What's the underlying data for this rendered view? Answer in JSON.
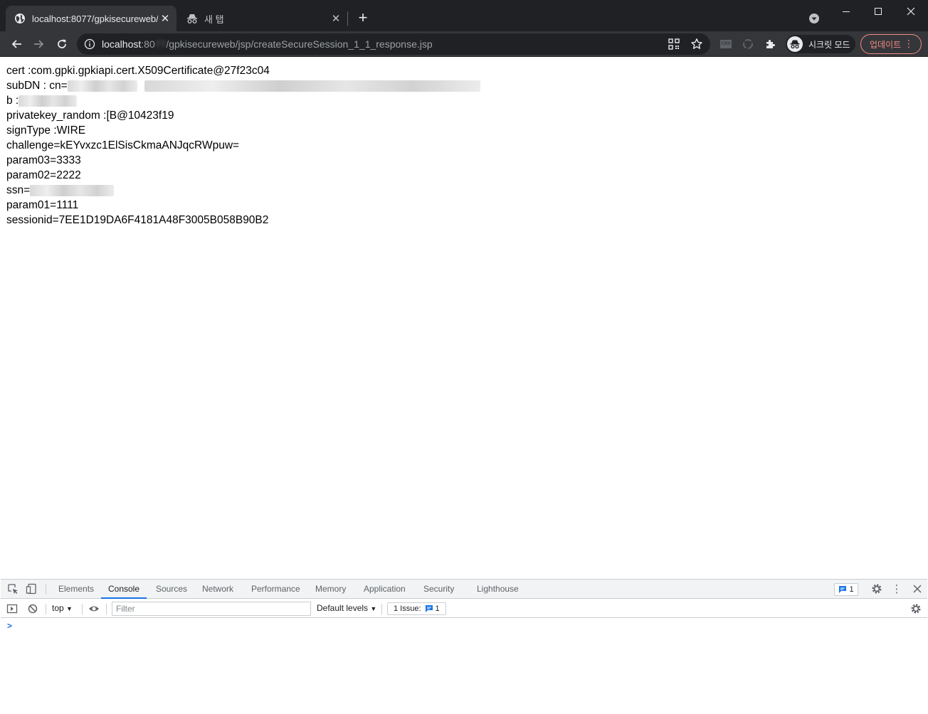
{
  "browser": {
    "tabs": [
      {
        "title": "localhost:8077/gpkisecureweb/jsp/createSecureSession_1_1_response.jsp",
        "active": true
      },
      {
        "title": "새 탭",
        "active": false
      }
    ],
    "address_host": "localhost",
    "address_port": ":80",
    "address_port_blur": "77",
    "address_path": "/gpkisecureweb/jsp/createSecureSession_1_1_response.jsp",
    "extension_crx": "CRX",
    "incognito_label": "시크릿 모드",
    "update_label": "업데이트"
  },
  "page": {
    "lines": [
      {
        "key": "cert : ",
        "value": "com.gpki.gpkiapi.cert.X509Certificate@27f23c04"
      },
      {
        "key": "subDN : cn=",
        "value": ""
      },
      {
        "key": "b : ",
        "value": ""
      },
      {
        "key": "privatekey_random : ",
        "value": "[B@10423f19"
      },
      {
        "key": "signType : ",
        "value": "WIRE"
      },
      {
        "key": "challenge=",
        "value": "kEYvxzc1ElSisCkmaANJqcRWpuw="
      },
      {
        "key": "param03=",
        "value": "3333"
      },
      {
        "key": "param02=",
        "value": "2222"
      },
      {
        "key": "ssn=",
        "value": ""
      },
      {
        "key": "param01=",
        "value": "1111"
      },
      {
        "key": "sessionid=",
        "value": "7EE1D19DA6F4181A48F3005B058B90B2"
      }
    ]
  },
  "devtools": {
    "tabs": [
      "Elements",
      "Console",
      "Sources",
      "Network",
      "Performance",
      "Memory",
      "Application",
      "Security",
      "Lighthouse"
    ],
    "active_tab": "Console",
    "badge_count": "1",
    "context": "top",
    "filter_placeholder": "Filter",
    "levels": "Default levels",
    "issues_label": "1 Issue:",
    "issues_count": "1",
    "prompt": ">"
  },
  "colors": {
    "chrome_dark": "#202124",
    "chrome_toolbar": "#35363a",
    "update_accent": "#f28b82",
    "devtools_accent": "#1a73e8"
  }
}
